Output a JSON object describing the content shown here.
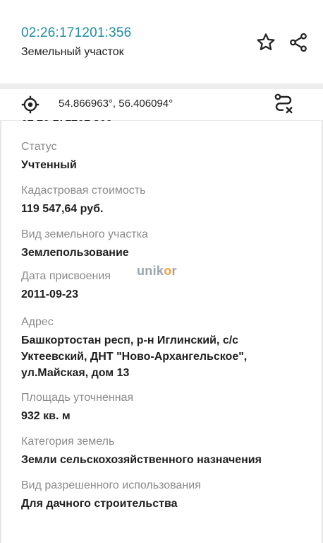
{
  "header": {
    "parcel_id": "02:26:171201:356",
    "parcel_type": "Земельный участок",
    "star_icon": "star-outline-icon",
    "share_icon": "share-icon"
  },
  "coordinates": {
    "locate_icon": "crosshair-icon",
    "value": "54.866963°, 56.406094°",
    "route_icon": "route-cancel-icon"
  },
  "fields": [
    {
      "label": "Статус",
      "value": "Учтенный"
    },
    {
      "label": "Кадастровая стоимость",
      "value": "119 547,64 руб."
    },
    {
      "label": "Вид земельного участка",
      "value": "Землепользование"
    },
    {
      "label": "Дата присвоения",
      "value": "2011-09-23"
    },
    {
      "label": "Адрес",
      "value": "Башкортостан респ, р-н Иглинский, с/с Уктеевский, ДНТ \"Ново-Архангельское\", ул.Майская, дом 13"
    },
    {
      "label": "Площадь уточненная",
      "value": "932 кв. м"
    },
    {
      "label": "Категория земель",
      "value": "Земли сельскохозяйственного назначения"
    },
    {
      "label": "Вид разрешенного использования",
      "value": "Для дачного строительства"
    }
  ],
  "watermark": {
    "text_before": "unik",
    "text_dot": "o",
    "text_after": "r"
  },
  "colors": {
    "accent": "#1f8ca0",
    "label": "#8a8a8a",
    "watermark_dot": "#f2a03c"
  }
}
